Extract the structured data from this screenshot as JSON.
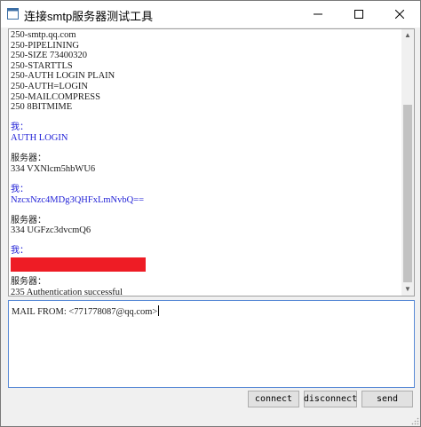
{
  "window": {
    "title": "连接smtp服务器测试工具",
    "controls": {
      "minimize": "—",
      "maximize": "☐",
      "close": "✕"
    }
  },
  "log": {
    "server_lines_top": [
      "250-smtp.qq.com",
      "250-PIPELINING",
      "250-SIZE 73400320",
      "250-STARTTLS",
      "250-AUTH LOGIN PLAIN",
      "250-AUTH=LOGIN",
      "250-MAILCOMPRESS",
      "250 8BITMIME"
    ],
    "me_label": "我：",
    "server_label": "服务器：",
    "me_1": "AUTH LOGIN",
    "server_1": "334 VXNlcm5hbWU6",
    "me_2": "NzcxNzc4MDg3QHFxLmNvbQ==",
    "server_2": "334 UGFzc3dvcmQ6",
    "server_3": "235 Authentication successful"
  },
  "input": {
    "value": "MAIL FROM: <771778087@qq.com>"
  },
  "buttons": {
    "connect": "connect",
    "disconnect": "disconnect",
    "send": "send"
  },
  "colors": {
    "me_text": "#1f1fd6",
    "redaction": "#ee1c25",
    "input_focus_border": "#5a8bd6"
  }
}
